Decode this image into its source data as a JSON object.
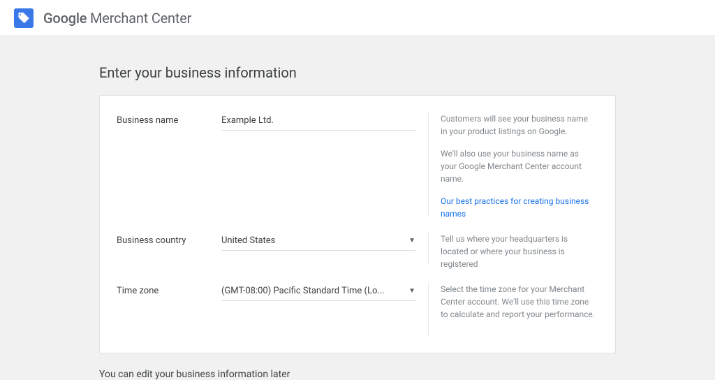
{
  "header": {
    "brand_google": "Google",
    "brand_product": " Merchant Center"
  },
  "page": {
    "title": "Enter your business information",
    "footer_note": "You can edit your business information later"
  },
  "form": {
    "business_name": {
      "label": "Business name",
      "value": "Example Ltd.",
      "help1": "Customers will see your business name in your product listings on Google.",
      "help2": "We'll also use your business name as your Google Merchant Center account name.",
      "link": "Our best practices for creating business names"
    },
    "business_country": {
      "label": "Business country",
      "value": "United States",
      "help": "Tell us where your headquarters is located or where your business is registered"
    },
    "time_zone": {
      "label": "Time zone",
      "value": "(GMT-08:00) Pacific Standard Time (Lo...",
      "help": "Select the time zone for your Merchant Center account. We'll use this time zone to calculate and report your performance."
    }
  }
}
